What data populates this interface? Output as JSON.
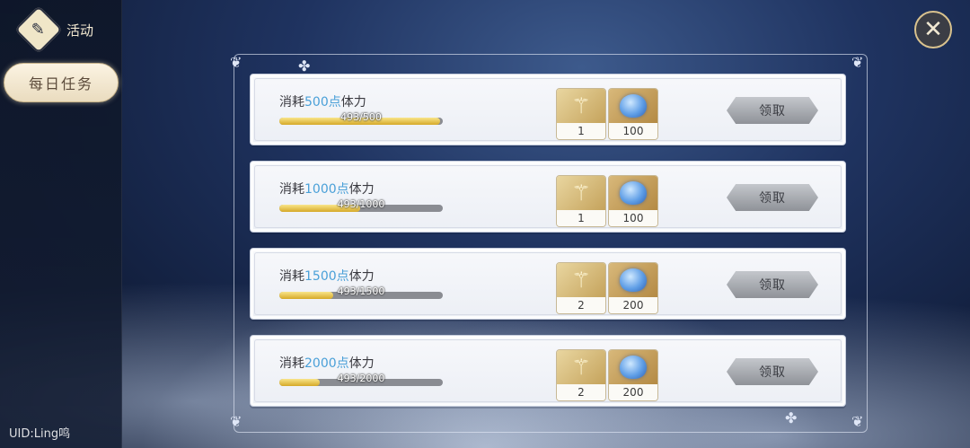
{
  "sidebar": {
    "header_title": "活动",
    "active_tab": "每日任务",
    "uid": "UID:Ling鸣"
  },
  "close_icon": "close-icon",
  "tasks": [
    {
      "prefix": "消耗",
      "amount": "500点",
      "suffix": "体力",
      "progress_text": "493/500",
      "progress": 0.986,
      "rewards": [
        {
          "icon": "wand-icon",
          "count": "1"
        },
        {
          "icon": "slime-gem-icon",
          "count": "100"
        }
      ],
      "claim_label": "领取"
    },
    {
      "prefix": "消耗",
      "amount": "1000点",
      "suffix": "体力",
      "progress_text": "493/1000",
      "progress": 0.493,
      "rewards": [
        {
          "icon": "wand-icon",
          "count": "1"
        },
        {
          "icon": "slime-gem-icon",
          "count": "100"
        }
      ],
      "claim_label": "领取"
    },
    {
      "prefix": "消耗",
      "amount": "1500点",
      "suffix": "体力",
      "progress_text": "493/1500",
      "progress": 0.329,
      "rewards": [
        {
          "icon": "wand-icon",
          "count": "2"
        },
        {
          "icon": "slime-gem-icon",
          "count": "200"
        }
      ],
      "claim_label": "领取"
    },
    {
      "prefix": "消耗",
      "amount": "2000点",
      "suffix": "体力",
      "progress_text": "493/2000",
      "progress": 0.2465,
      "rewards": [
        {
          "icon": "wand-icon",
          "count": "2"
        },
        {
          "icon": "slime-gem-icon",
          "count": "200"
        }
      ],
      "claim_label": "领取"
    }
  ],
  "colors": {
    "highlight": "#4aa0d8",
    "progress_fill": "#e6c04a"
  }
}
